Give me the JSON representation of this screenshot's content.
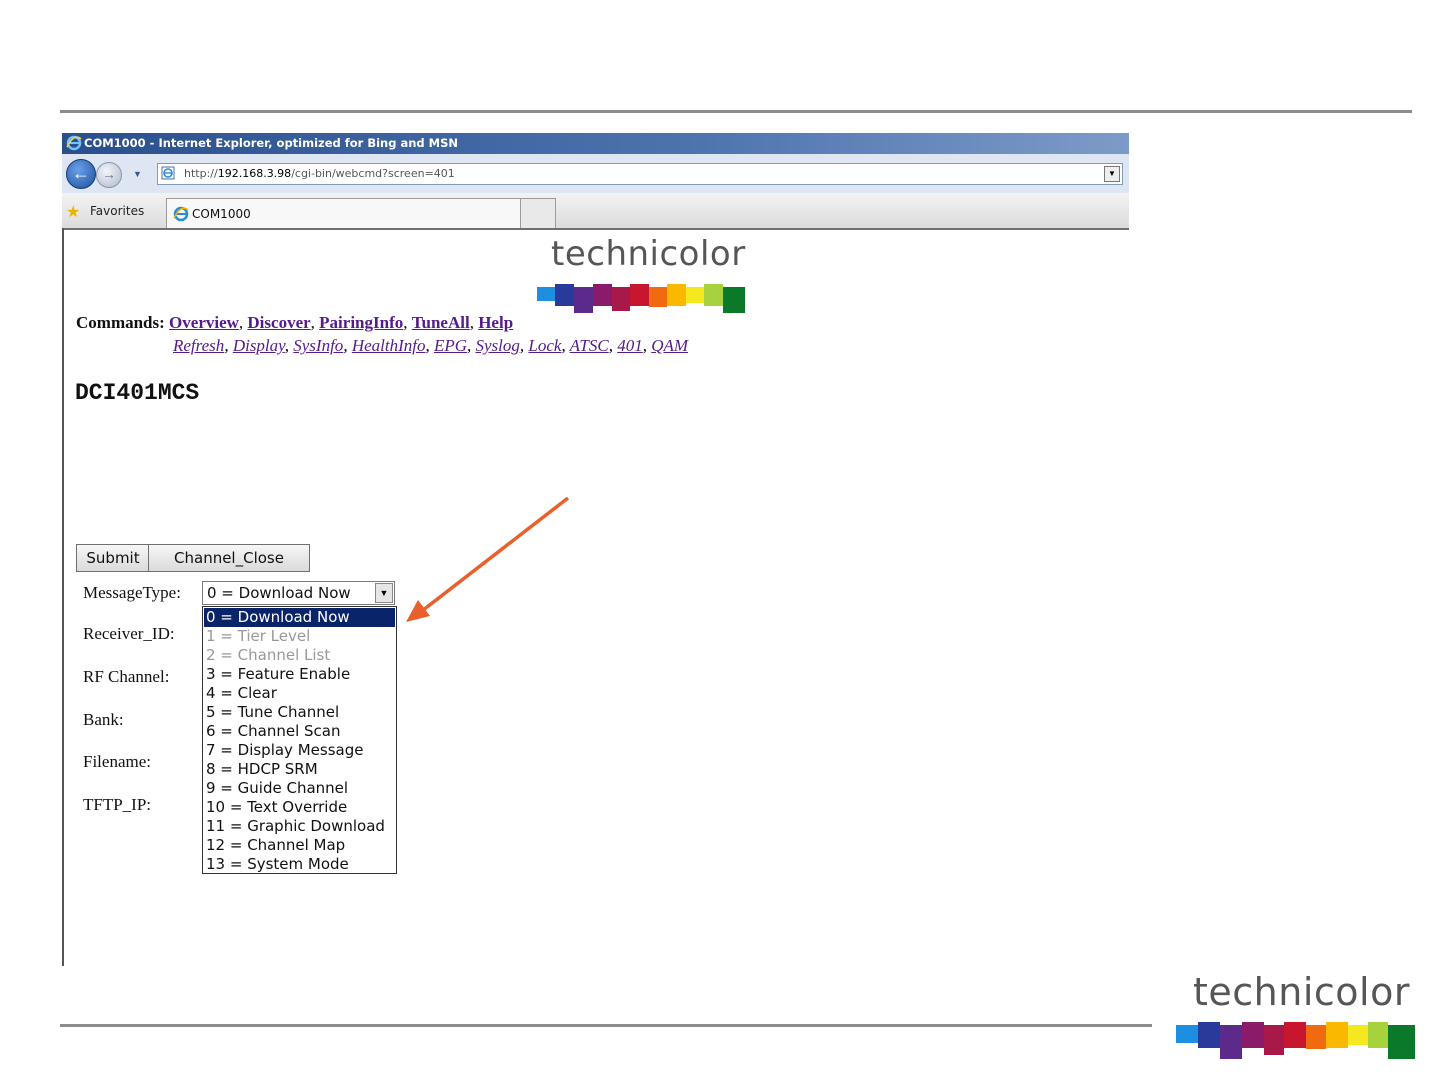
{
  "browser": {
    "title": "COM1000 - Internet Explorer, optimized for Bing and MSN",
    "url_prefix": "http://",
    "url_host": "192.168.3.98",
    "url_path": "/cgi-bin/webcmd?screen=401",
    "favorites_label": "Favorites",
    "tab_label": "COM1000"
  },
  "page": {
    "logo_text": "technicolor",
    "commands_label": "Commands:",
    "commands_primary": [
      "Overview",
      "Discover",
      "PairingInfo",
      "TuneAll",
      "Help"
    ],
    "commands_secondary": [
      "Refresh",
      "Display",
      "SysInfo",
      "HealthInfo",
      "EPG",
      "Syslog",
      "Lock",
      "ATSC",
      "401",
      "QAM"
    ],
    "title": "DCI401MCS"
  },
  "form": {
    "submit_label": "Submit",
    "channel_close_label": "Channel_Close",
    "labels": {
      "message_type": "MessageType:",
      "receiver_id": "Receiver_ID:",
      "rf_channel": "RF Channel:",
      "bank": "Bank:",
      "filename": "Filename:",
      "tftp_ip": "TFTP_IP:"
    },
    "message_type_selected": "0 = Download Now",
    "message_type_options": [
      "0 = Download Now",
      "1 = Tier Level",
      "2 = Channel List",
      "3 = Feature Enable",
      "4 = Clear",
      "5 = Tune Channel",
      "6 = Channel Scan",
      "7 = Display Message",
      "8 = HDCP SRM",
      "9 = Guide Channel",
      "10 = Text Override",
      "11 = Graphic Download",
      "12 = Channel Map",
      "13 = System Mode"
    ],
    "disabled_options": [
      1,
      2
    ]
  },
  "footer": {
    "logo_text": "technicolor"
  },
  "colors": {
    "annotation_arrow": "#e8602c",
    "selection_highlight": "#0a246a",
    "link": "#551a8b",
    "logo_bars": [
      "#1e8fe0",
      "#2a3a9a",
      "#5b2a8a",
      "#8a1a6a",
      "#c8162e",
      "#f06a10",
      "#fbb800",
      "#f5e81e",
      "#a8d23c",
      "#3aa83a",
      "#0a7a2a"
    ]
  }
}
